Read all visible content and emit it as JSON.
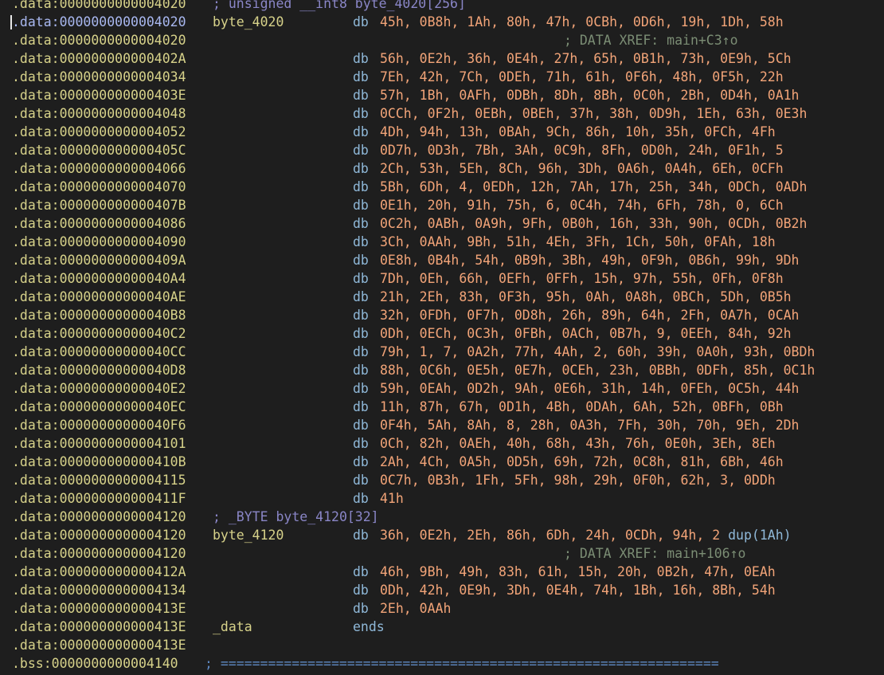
{
  "listing": {
    "lines": [
      {
        "seg": ".data:0000000000004020",
        "comment": "; unsigned __int8 byte_4020[256]",
        "kind": "decl"
      },
      {
        "seg": ".data:0000000000004020",
        "label": "byte_4020",
        "mnem": "db",
        "ops": "45h, 0B8h, 1Ah, 80h, 47h, 0CBh, 0D6h, 19h, 1Dh, 58h",
        "current": true
      },
      {
        "seg": ".data:0000000000004020",
        "comment": "; DATA XREF: main+C3↑o",
        "kind": "xref"
      },
      {
        "seg": ".data:000000000000402A",
        "mnem": "db",
        "ops": "56h, 0E2h, 36h, 0E4h, 27h, 65h, 0B1h, 73h, 0E9h, 5Ch"
      },
      {
        "seg": ".data:0000000000004034",
        "mnem": "db",
        "ops": "7Eh, 42h, 7Ch, 0DEh, 71h, 61h, 0F6h, 48h, 0F5h, 22h"
      },
      {
        "seg": ".data:000000000000403E",
        "mnem": "db",
        "ops": "57h, 1Bh, 0AFh, 0DBh, 8Dh, 8Bh, 0C0h, 2Bh, 0D4h, 0A1h"
      },
      {
        "seg": ".data:0000000000004048",
        "mnem": "db",
        "ops": "0CCh, 0F2h, 0EBh, 0BEh, 37h, 38h, 0D9h, 1Eh, 63h, 0E3h"
      },
      {
        "seg": ".data:0000000000004052",
        "mnem": "db",
        "ops": "4Dh, 94h, 13h, 0BAh, 9Ch, 86h, 10h, 35h, 0FCh, 4Fh"
      },
      {
        "seg": ".data:000000000000405C",
        "mnem": "db",
        "ops": "0D7h, 0D3h, 7Bh, 3Ah, 0C9h, 8Fh, 0D0h, 24h, 0F1h, 5"
      },
      {
        "seg": ".data:0000000000004066",
        "mnem": "db",
        "ops": "2Ch, 53h, 5Eh, 8Ch, 96h, 3Dh, 0A6h, 0A4h, 6Eh, 0CFh"
      },
      {
        "seg": ".data:0000000000004070",
        "mnem": "db",
        "ops": "5Bh, 6Dh, 4, 0EDh, 12h, 7Ah, 17h, 25h, 34h, 0DCh, 0ADh"
      },
      {
        "seg": ".data:000000000000407B",
        "mnem": "db",
        "ops": "0E1h, 20h, 91h, 75h, 6, 0C4h, 74h, 6Fh, 78h, 0, 6Ch"
      },
      {
        "seg": ".data:0000000000004086",
        "mnem": "db",
        "ops": "0C2h, 0ABh, 0A9h, 9Fh, 0B0h, 16h, 33h, 90h, 0CDh, 0B2h"
      },
      {
        "seg": ".data:0000000000004090",
        "mnem": "db",
        "ops": "3Ch, 0AAh, 9Bh, 51h, 4Eh, 3Fh, 1Ch, 50h, 0FAh, 18h"
      },
      {
        "seg": ".data:000000000000409A",
        "mnem": "db",
        "ops": "0E8h, 0B4h, 54h, 0B9h, 3Bh, 49h, 0F9h, 0B6h, 99h, 9Dh"
      },
      {
        "seg": ".data:00000000000040A4",
        "mnem": "db",
        "ops": "7Dh, 0Eh, 66h, 0EFh, 0FFh, 15h, 97h, 55h, 0Fh, 0F8h"
      },
      {
        "seg": ".data:00000000000040AE",
        "mnem": "db",
        "ops": "21h, 2Eh, 83h, 0F3h, 95h, 0Ah, 0A8h, 0BCh, 5Dh, 0B5h"
      },
      {
        "seg": ".data:00000000000040B8",
        "mnem": "db",
        "ops": "32h, 0FDh, 0F7h, 0D8h, 26h, 89h, 64h, 2Fh, 0A7h, 0CAh"
      },
      {
        "seg": ".data:00000000000040C2",
        "mnem": "db",
        "ops": "0Dh, 0ECh, 0C3h, 0FBh, 0ACh, 0B7h, 9, 0EEh, 84h, 92h"
      },
      {
        "seg": ".data:00000000000040CC",
        "mnem": "db",
        "ops": "79h, 1, 7, 0A2h, 77h, 4Ah, 2, 60h, 39h, 0A0h, 93h, 0BDh"
      },
      {
        "seg": ".data:00000000000040D8",
        "mnem": "db",
        "ops": "88h, 0C6h, 0E5h, 0E7h, 0CEh, 23h, 0BBh, 0DFh, 85h, 0C1h"
      },
      {
        "seg": ".data:00000000000040E2",
        "mnem": "db",
        "ops": "59h, 0EAh, 0D2h, 9Ah, 0E6h, 31h, 14h, 0FEh, 0C5h, 44h"
      },
      {
        "seg": ".data:00000000000040EC",
        "mnem": "db",
        "ops": "11h, 87h, 67h, 0D1h, 4Bh, 0DAh, 6Ah, 52h, 0BFh, 0Bh"
      },
      {
        "seg": ".data:00000000000040F6",
        "mnem": "db",
        "ops": "0F4h, 5Ah, 8Ah, 8, 28h, 0A3h, 7Fh, 30h, 70h, 9Eh, 2Dh"
      },
      {
        "seg": ".data:0000000000004101",
        "mnem": "db",
        "ops": "0Ch, 82h, 0AEh, 40h, 68h, 43h, 76h, 0E0h, 3Eh, 8Eh"
      },
      {
        "seg": ".data:000000000000410B",
        "mnem": "db",
        "ops": "2Ah, 4Ch, 0A5h, 0D5h, 69h, 72h, 0C8h, 81h, 6Bh, 46h"
      },
      {
        "seg": ".data:0000000000004115",
        "mnem": "db",
        "ops": "0C7h, 0B3h, 1Fh, 5Fh, 98h, 29h, 0F0h, 62h, 3, 0DDh"
      },
      {
        "seg": ".data:000000000000411F",
        "mnem": "db",
        "ops": "41h"
      },
      {
        "seg": ".data:0000000000004120",
        "comment": "; _BYTE byte_4120[32]",
        "kind": "decl"
      },
      {
        "seg": ".data:0000000000004120",
        "label": "byte_4120",
        "mnem": "db",
        "ops": "36h, 0E2h, 2Eh, 86h, 6Dh, 24h, 0CDh, 94h, 2",
        "dup": " dup(1Ah)"
      },
      {
        "seg": ".data:0000000000004120",
        "comment": "; DATA XREF: main+106↑o",
        "kind": "xref"
      },
      {
        "seg": ".data:000000000000412A",
        "mnem": "db",
        "ops": "46h, 9Bh, 49h, 83h, 61h, 15h, 20h, 0B2h, 47h, 0EAh"
      },
      {
        "seg": ".data:0000000000004134",
        "mnem": "db",
        "ops": "0Dh, 42h, 0E9h, 3Dh, 0E4h, 74h, 1Bh, 16h, 8Bh, 54h"
      },
      {
        "seg": ".data:000000000000413E",
        "mnem": "db",
        "ops": "2Eh, 0AAh"
      },
      {
        "seg": ".data:000000000000413E",
        "label": "_data",
        "mnem": "ends"
      },
      {
        "seg": ".data:000000000000413E"
      },
      {
        "seg": ".bss:0000000000004140",
        "comment": "; ===============================================================",
        "kind": "sep"
      }
    ]
  },
  "colors": {
    "background": "#1e1e1e",
    "segment": "#d7d28a",
    "current_segment": "#a9b8f0",
    "mnemonic": "#8fb8d8",
    "operand": "#f2a478",
    "comment": "#7b8d74",
    "declaration": "#8a86c7"
  }
}
